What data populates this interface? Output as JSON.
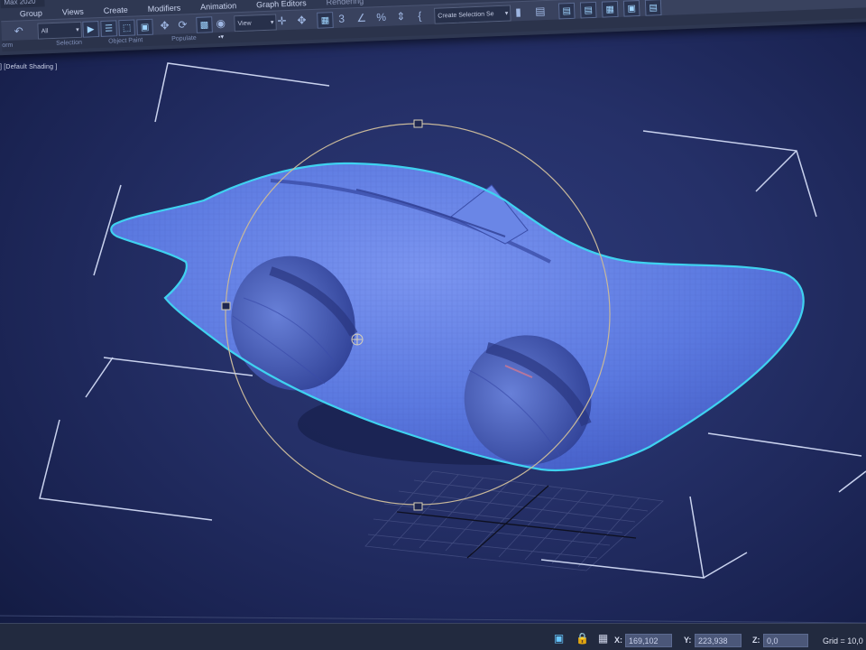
{
  "window": {
    "title": "Max 2020"
  },
  "menubar": {
    "items": [
      "Group",
      "Views",
      "Create",
      "Modifiers",
      "Animation",
      "Graph Editors",
      "Rendering"
    ]
  },
  "toolbar": {
    "filter_dropdown": "All",
    "reference_coord_dropdown": "View",
    "snap_label": "3",
    "selection_set_dropdown": "Create Selection Se",
    "icons": [
      "select-object-icon",
      "select-by-name-icon",
      "rectangular-selection-icon",
      "window-crossing-icon",
      "select-move-icon",
      "select-rotate-icon",
      "select-scale-icon",
      "pivot-icon",
      "select-manipulate-icon",
      "keyboard-shortcut-icon",
      "snap-toggle-icon",
      "angle-snap-icon",
      "percent-snap-icon",
      "spinner-snap-icon",
      "named-selection-icon",
      "mirror-icon",
      "align-icon"
    ],
    "sublabels": {
      "left": "orm",
      "selection": "Selection",
      "object_paint": "Object Paint",
      "populate": "Populate"
    }
  },
  "viewport": {
    "label": "] [Default Shading ]"
  },
  "statusbar": {
    "x_label": "X:",
    "x_value": "169,102",
    "y_label": "Y:",
    "y_value": "223,938",
    "z_label": "Z:",
    "z_value": "0,0",
    "grid": "Grid = 10,0"
  },
  "colors": {
    "model_fill": "#5b79e0",
    "selection_outline": "#3fd2f0",
    "gizmo": "#c8b89a",
    "bracket": "#c9d2ee",
    "accent": "#67c6ff"
  }
}
